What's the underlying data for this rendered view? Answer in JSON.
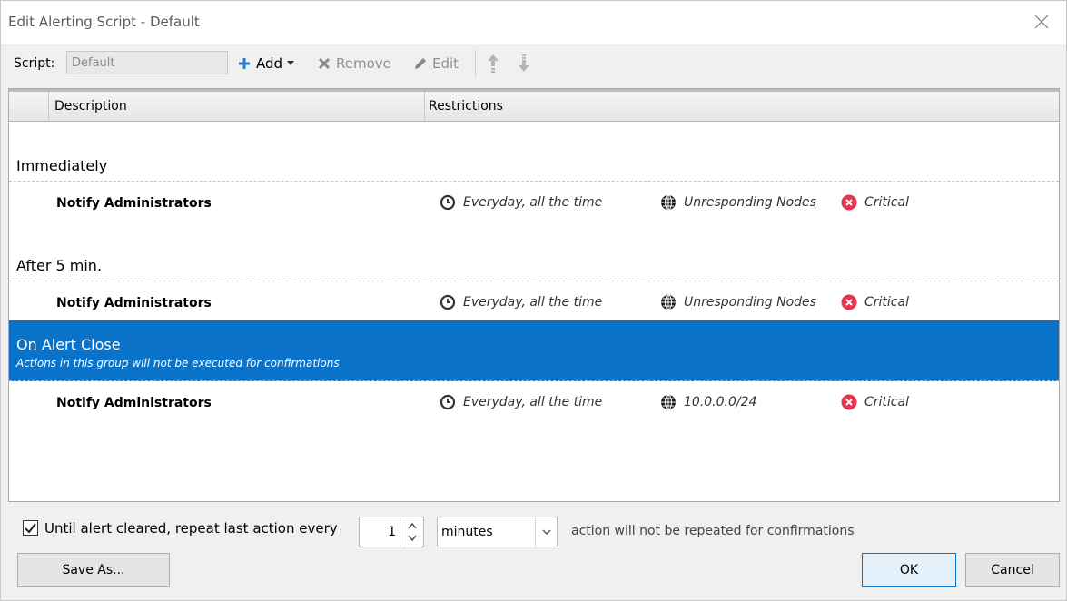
{
  "window": {
    "title": "Edit Alerting Script - Default"
  },
  "toolbar": {
    "script_label": "Script:",
    "script_value": "Default",
    "add_label": "Add",
    "remove_label": "Remove",
    "edit_label": "Edit"
  },
  "grid": {
    "columns": [
      "Description",
      "Restrictions"
    ],
    "groups": [
      {
        "title": "Immediately",
        "actions": [
          {
            "name": "Notify Administrators",
            "schedule": "Everyday, all the time",
            "nodes": "Unresponding Nodes",
            "severity": "Critical"
          }
        ]
      },
      {
        "title": "After 5 min.",
        "actions": [
          {
            "name": "Notify Administrators",
            "schedule": "Everyday, all the time",
            "nodes": "Unresponding Nodes",
            "severity": "Critical"
          }
        ]
      },
      {
        "title": "On Alert Close",
        "subtitle": "Actions in this group will not be executed for confirmations",
        "selected": true,
        "actions": [
          {
            "name": "Notify Administrators",
            "schedule": "Everyday, all the time",
            "nodes": "10.0.0.0/24",
            "severity": "Critical"
          }
        ]
      }
    ]
  },
  "footer": {
    "repeat_checked": true,
    "repeat_label": "Until alert cleared, repeat last action every",
    "repeat_value": "1",
    "unit_value": "minutes",
    "note": "action will not be repeated for confirmations",
    "save_as_label": "Save As...",
    "ok_label": "OK",
    "cancel_label": "Cancel"
  },
  "colors": {
    "accent": "#0a72c9",
    "critical": "#e8344e"
  },
  "icons": [
    "close-icon",
    "plus-icon",
    "dropdown-arrow-icon",
    "remove-icon",
    "edit-icon",
    "move-up-icon",
    "move-down-icon",
    "clock-icon",
    "globe-icon",
    "critical-icon",
    "checkbox-check-icon"
  ]
}
